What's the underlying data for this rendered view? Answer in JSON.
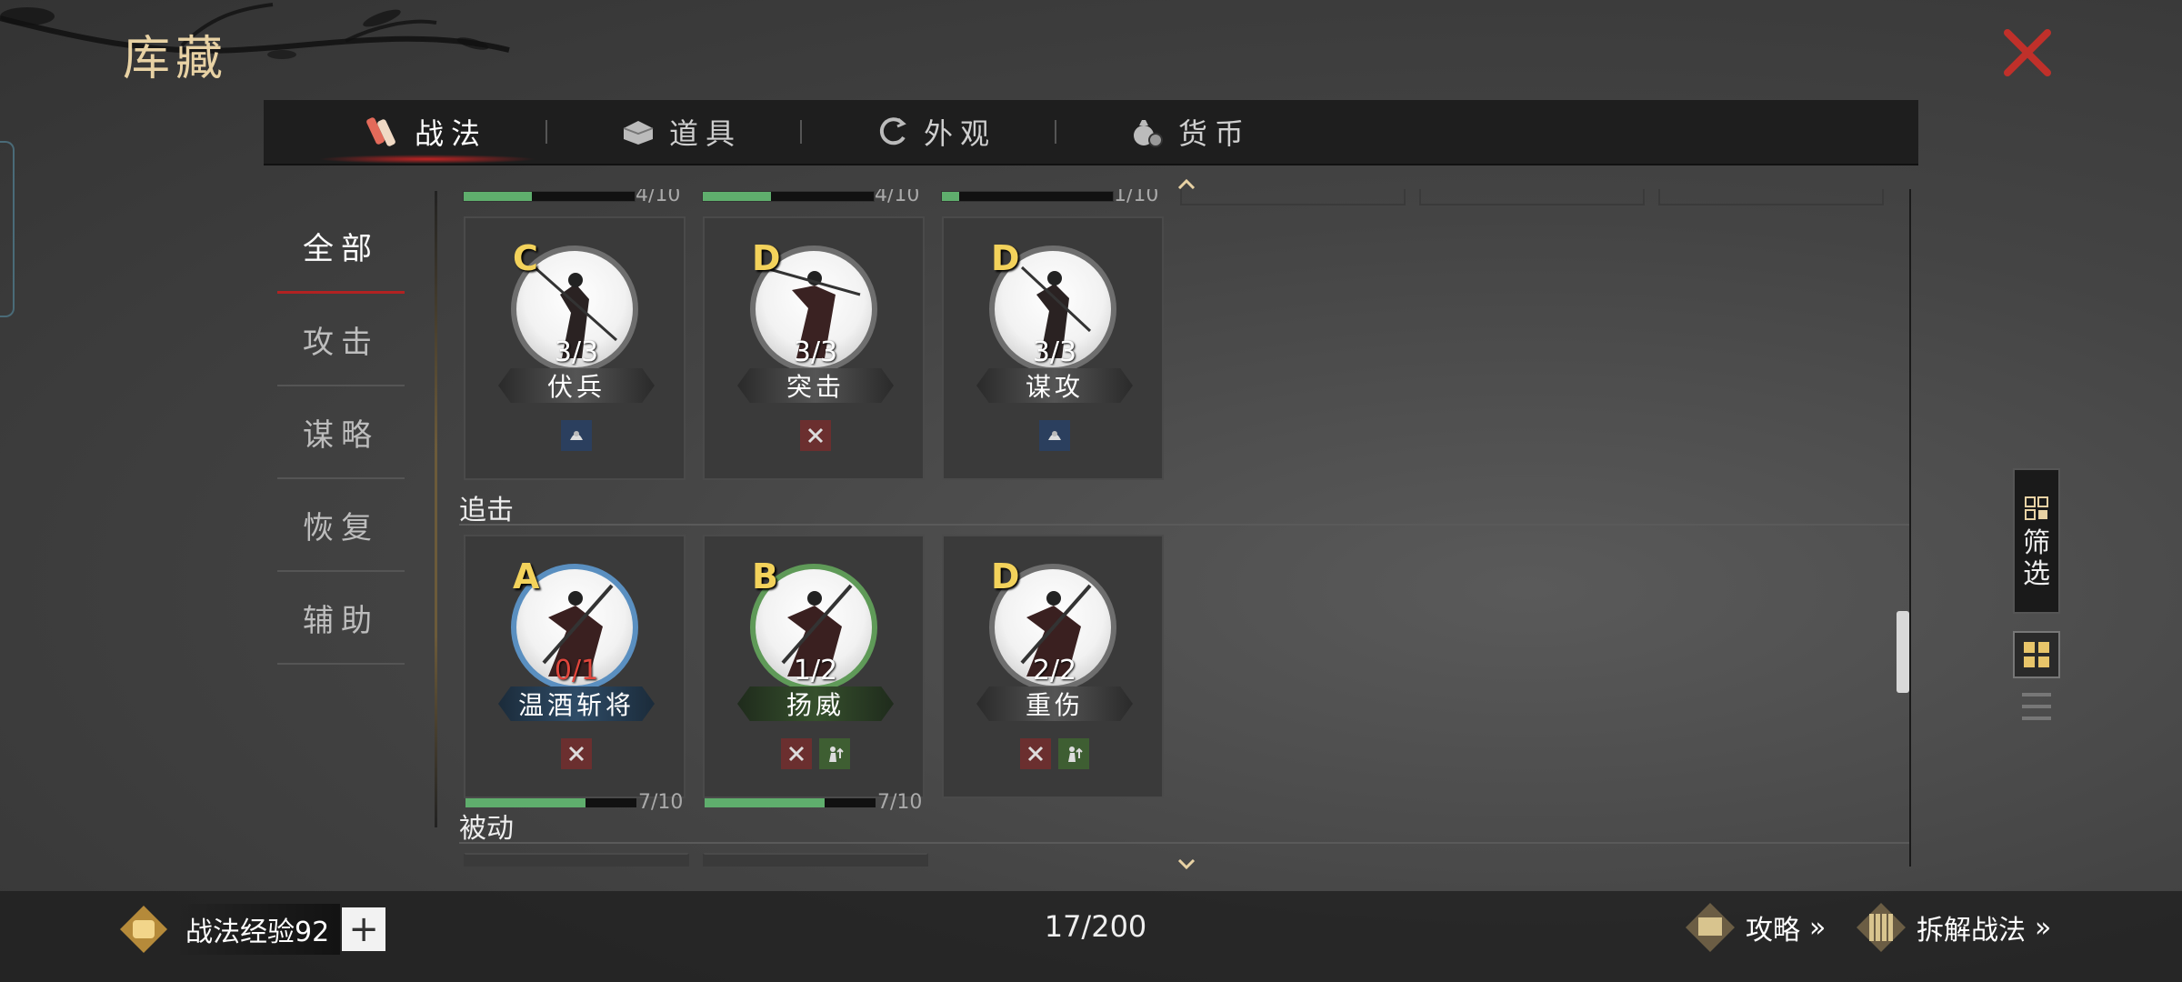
{
  "header": {
    "title": "库藏"
  },
  "tabs": [
    {
      "label": "战法",
      "icon": "scroll-bundle-icon",
      "active": true
    },
    {
      "label": "道具",
      "icon": "chest-icon",
      "active": false
    },
    {
      "label": "外观",
      "icon": "swirl-icon",
      "active": false
    },
    {
      "label": "货币",
      "icon": "money-bag-icon",
      "active": false
    }
  ],
  "categories": [
    {
      "label": "全部",
      "active": true
    },
    {
      "label": "攻击"
    },
    {
      "label": "谋略"
    },
    {
      "label": "恢复"
    },
    {
      "label": "辅助"
    }
  ],
  "top_partial_progress": [
    {
      "text": "4/10",
      "value": 0.4
    },
    {
      "text": "4/10",
      "value": 0.4
    },
    {
      "text": "1/10",
      "value": 0.1
    }
  ],
  "group1_cards": [
    {
      "grade": "C",
      "count": "3/3",
      "name": "伏兵",
      "tags": [
        "strategy-icon"
      ]
    },
    {
      "grade": "D",
      "count": "3/3",
      "name": "突击",
      "tags": [
        "attack-icon"
      ]
    },
    {
      "grade": "D",
      "count": "3/3",
      "name": "谋攻",
      "tags": [
        "strategy-icon"
      ]
    }
  ],
  "sections": {
    "pursuit": "追击",
    "passive": "被动"
  },
  "group2_cards": [
    {
      "grade": "A",
      "count": "0/1",
      "name": "温酒斩将",
      "tags": [
        "attack-icon"
      ],
      "progress_text": "7/10",
      "progress": 0.7
    },
    {
      "grade": "B",
      "count": "1/2",
      "name": "扬威",
      "tags": [
        "attack-icon",
        "buff-icon"
      ],
      "progress_text": "7/10",
      "progress": 0.7
    },
    {
      "grade": "D",
      "count": "2/2",
      "name": "重伤",
      "tags": [
        "attack-icon",
        "buff-icon"
      ]
    }
  ],
  "side": {
    "filter_label": "筛选"
  },
  "footer": {
    "exp_label": "战法经验92",
    "plus": "+",
    "capacity": "17/200",
    "guide": "攻略",
    "dismantle": "拆解战法"
  },
  "colors": {
    "accent_red": "#c02424",
    "grade_gold": "#f3d25b",
    "progress_green": "#5fae6d"
  }
}
